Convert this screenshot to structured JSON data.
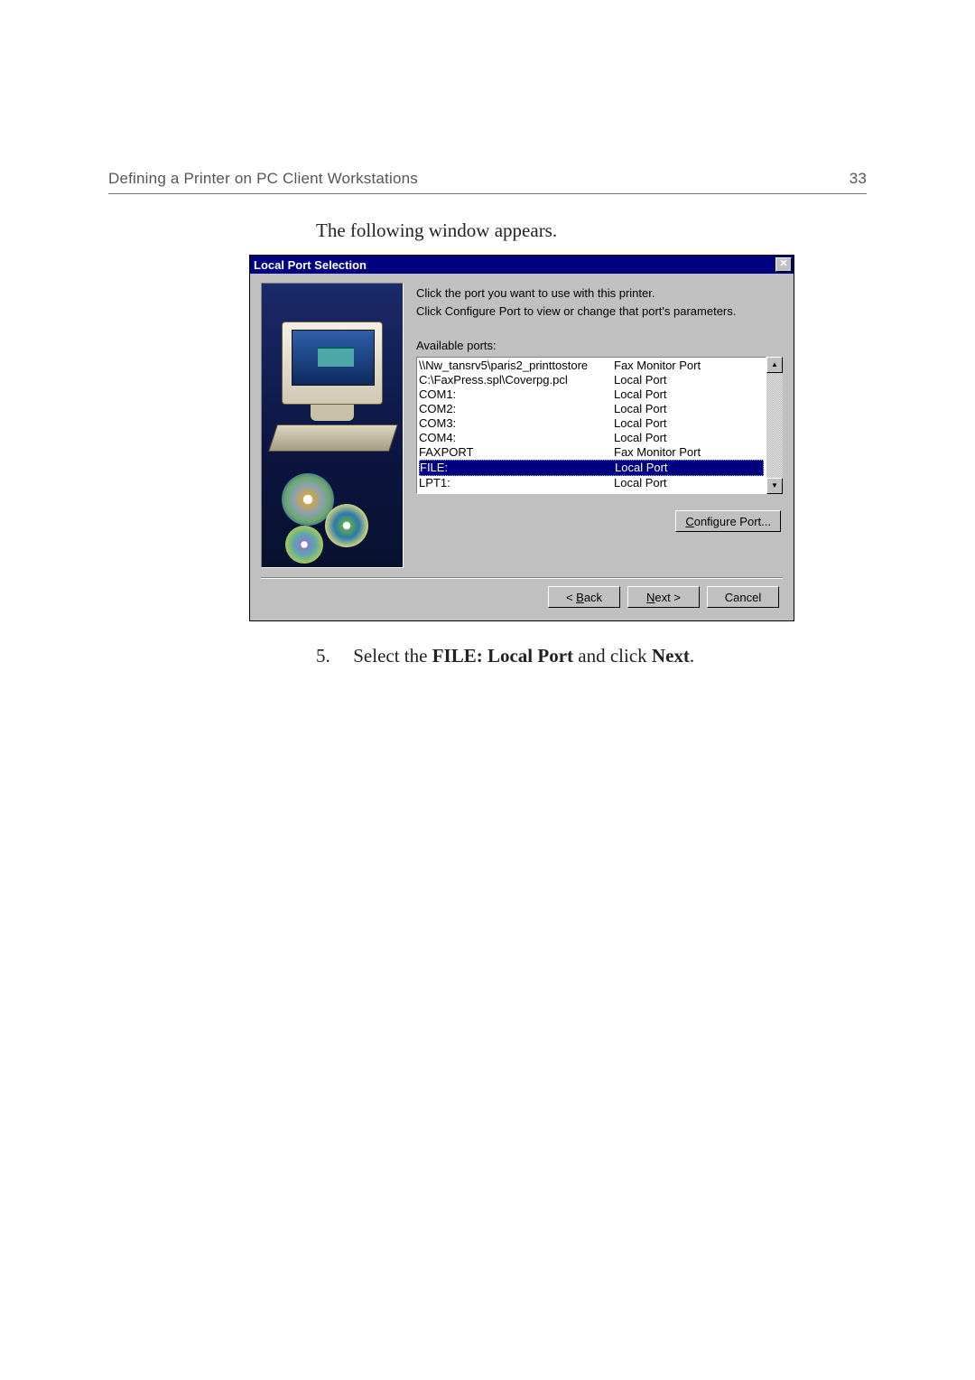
{
  "page": {
    "header_left": "Defining a Printer on PC Client Workstations",
    "header_right": "33",
    "intro": "The following window appears.",
    "step_number": "5.",
    "step_text_before": "Select the ",
    "step_bold1": "FILE: Local Port",
    "step_text_mid": " and click ",
    "step_bold2": "Next",
    "step_text_after": "."
  },
  "dialog": {
    "title": "Local Port Selection",
    "close_glyph": "✕",
    "prompt1": "Click the port you want to use with this printer.",
    "prompt2": "Click Configure Port to view or change that port's parameters.",
    "list_label": "Available ports:",
    "ports": [
      {
        "name": "\\\\Nw_tansrv5\\paris2_printtostore",
        "type": "Fax Monitor Port",
        "selected": false
      },
      {
        "name": "C:\\FaxPress.spl\\Coverpg.pcl",
        "type": "Local Port",
        "selected": false
      },
      {
        "name": "COM1:",
        "type": "Local Port",
        "selected": false
      },
      {
        "name": "COM2:",
        "type": "Local Port",
        "selected": false
      },
      {
        "name": "COM3:",
        "type": "Local Port",
        "selected": false
      },
      {
        "name": "COM4:",
        "type": "Local Port",
        "selected": false
      },
      {
        "name": "FAXPORT",
        "type": "Fax Monitor Port",
        "selected": false
      },
      {
        "name": "FILE:",
        "type": "Local Port",
        "selected": true
      },
      {
        "name": "LPT1:",
        "type": "Local Port",
        "selected": false
      }
    ],
    "scroll_up": "▲",
    "scroll_down": "▼",
    "configure": {
      "pre": "",
      "u": "C",
      "post": "onfigure Port..."
    },
    "back": {
      "pre": "< ",
      "u": "B",
      "post": "ack"
    },
    "next": {
      "pre": "",
      "u": "N",
      "post": "ext >"
    },
    "cancel": "Cancel"
  }
}
